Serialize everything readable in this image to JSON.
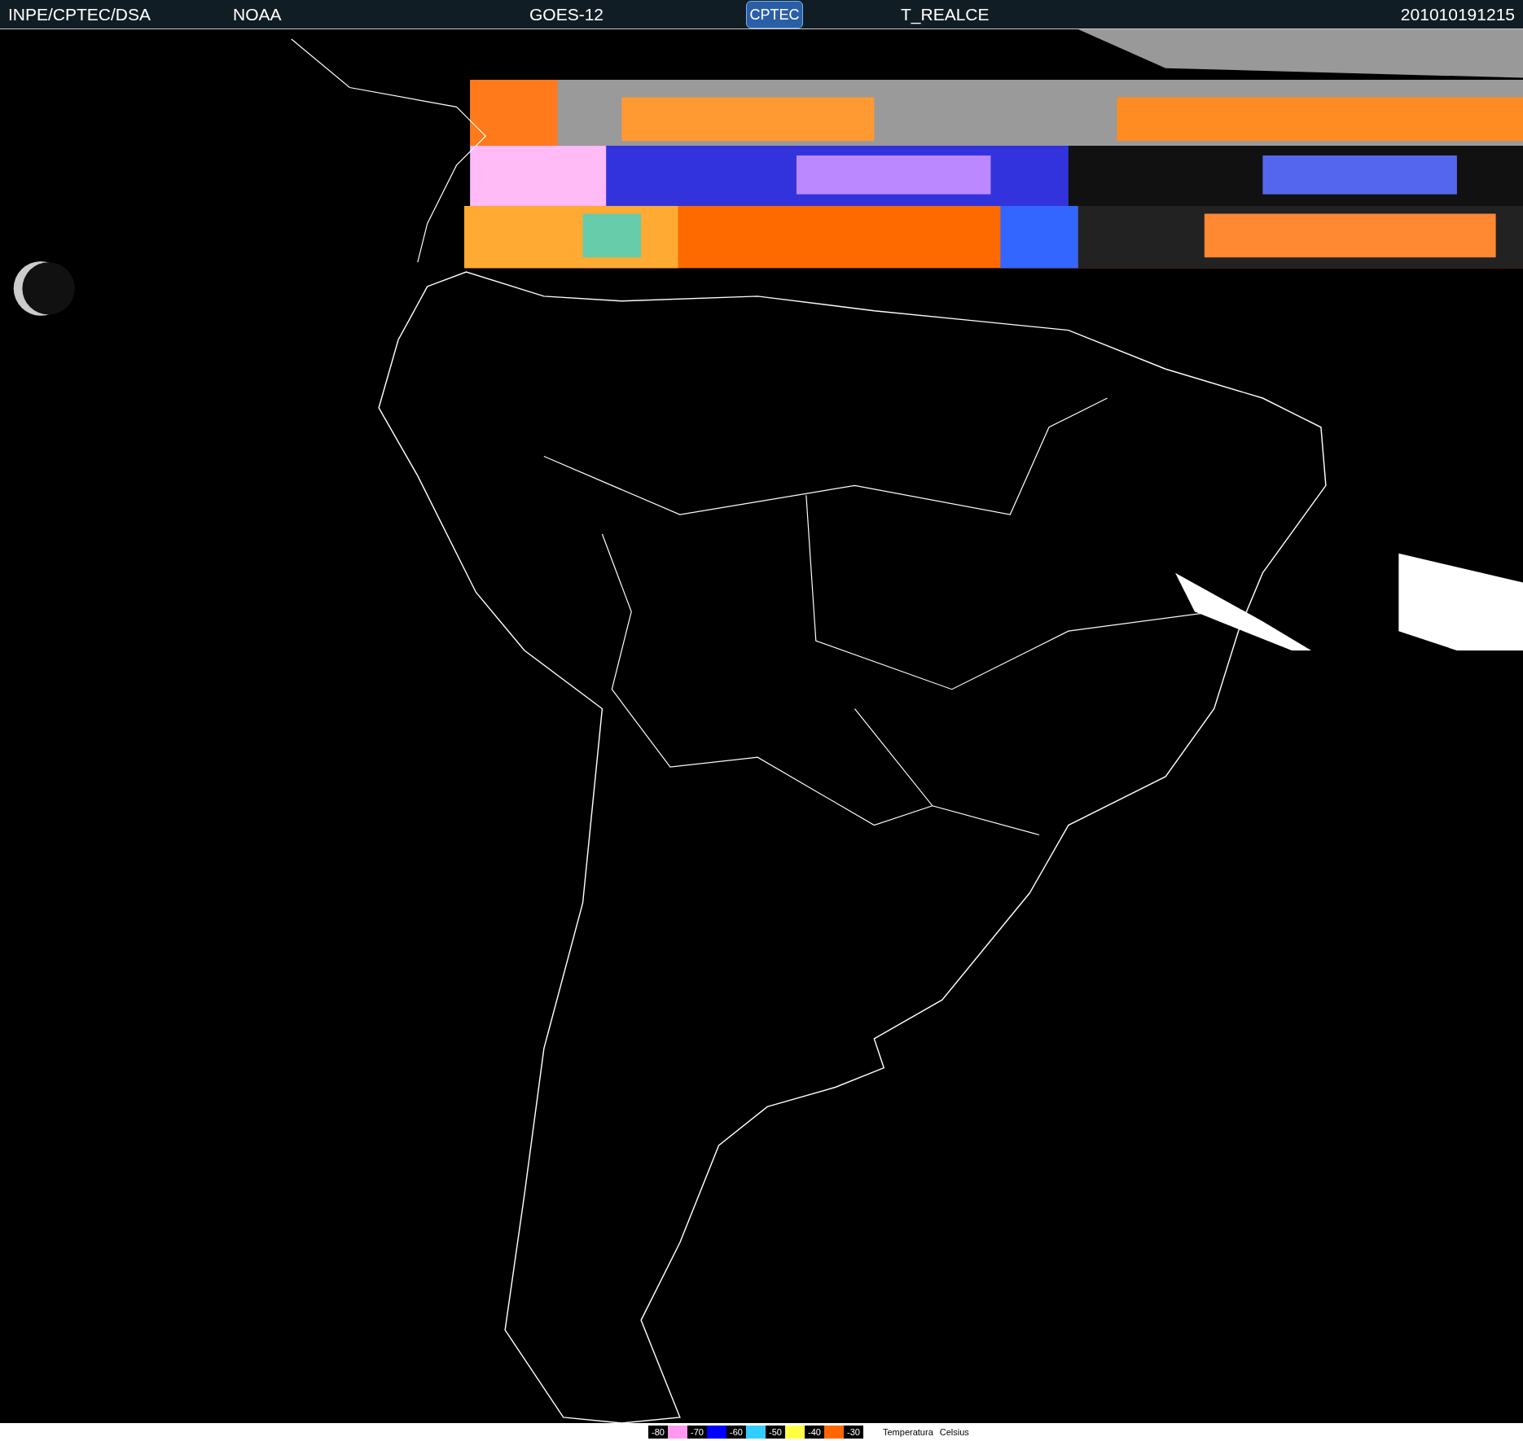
{
  "header": {
    "source": "INPE/CPTEC/DSA",
    "agency": "NOAA",
    "satellite": "GOES-12",
    "logo": "CPTEC",
    "product": "T_REALCE",
    "timestamp": "201010191215"
  },
  "legend": {
    "entries": [
      {
        "label": "-80",
        "color": "#ff99f0"
      },
      {
        "label": "-70",
        "color": "#0000ff"
      },
      {
        "label": "-60",
        "color": "#33ccff"
      },
      {
        "label": "-50",
        "color": "#ffff44"
      },
      {
        "label": "-40",
        "color": "#ff6600"
      },
      {
        "label": "-30"
      }
    ],
    "quantity": "Temperatura",
    "unit": "Celsius"
  }
}
